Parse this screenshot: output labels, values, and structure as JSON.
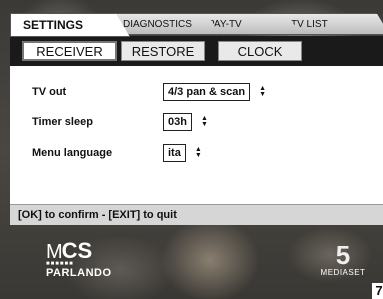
{
  "tabs": [
    {
      "label": "SETTINGS"
    },
    {
      "label": "DIAGNOSTICS"
    },
    {
      "label": "PAY-TV"
    },
    {
      "label": "TV LIST"
    }
  ],
  "subtabs": [
    {
      "label": "RECEIVER"
    },
    {
      "label": "RESTORE"
    },
    {
      "label": "CLOCK"
    }
  ],
  "settings": [
    {
      "label": "TV out",
      "value": "4/3 pan & scan"
    },
    {
      "label": "Timer sleep",
      "value": "03h"
    },
    {
      "label": "Menu language",
      "value": "ita"
    }
  ],
  "footer": {
    "hint": "[OK] to confirm - [EXIT] to quit"
  },
  "logos": {
    "mcs_m": "M",
    "mcs_cs": "CS",
    "mcs_sub": "PARLANDO",
    "channel": "MEDIASET"
  },
  "corner": {
    "number": "7"
  },
  "icons": {
    "spinner": "up-down-arrows-icon"
  }
}
